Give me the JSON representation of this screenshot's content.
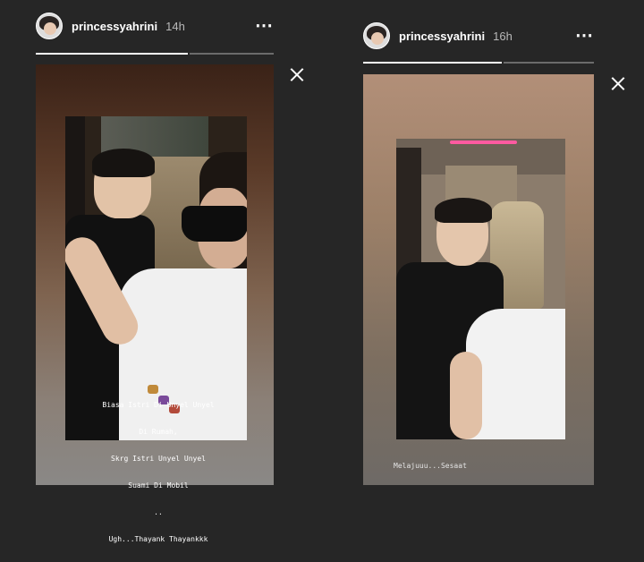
{
  "stories": [
    {
      "username": "princessyahrini",
      "time": "14h",
      "more_icon": "⋯",
      "progress": {
        "segments": 2,
        "current": 1,
        "fraction": 0.7
      },
      "caption_lines": [
        "Biasa Istri Di Unyel Unyel",
        "Di Rumah,",
        "Skrg Istri Unyel Unyel",
        "Suami Di Mobil",
        "..",
        "Ugh...Thayank Thayankkk"
      ]
    },
    {
      "username": "princessyahrini",
      "time": "16h",
      "more_icon": "⋯",
      "progress": {
        "segments": 2,
        "current": 1,
        "fraction": 0.6
      },
      "caption_lines": [
        "Melajuuu...Sesaat"
      ]
    }
  ],
  "icons": {
    "close": "close-icon",
    "more": "more-options-icon",
    "avatar": "avatar"
  },
  "colors": {
    "background": "#262626",
    "progress_done": "#ffffff",
    "progress_todo": "#6b6b6b",
    "accent_light": "#ff5aa0"
  }
}
